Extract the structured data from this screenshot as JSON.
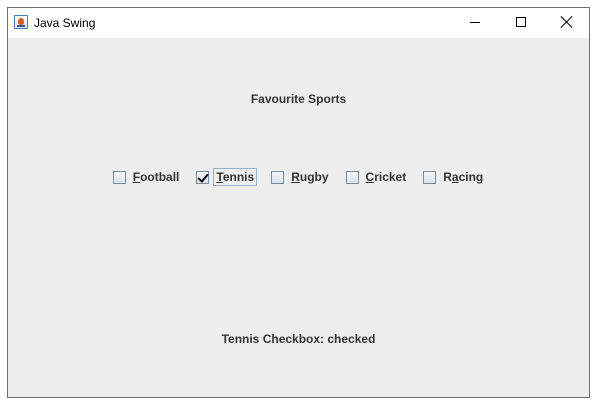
{
  "window": {
    "title": "Java Swing",
    "icon": "java-cup-icon"
  },
  "controls": {
    "minimize_icon": "minimize-icon",
    "maximize_icon": "maximize-icon",
    "close_icon": "close-icon"
  },
  "heading": "Favourite Sports",
  "checkboxes": [
    {
      "pre": "",
      "mnemonic": "F",
      "post": "ootball",
      "checked": false
    },
    {
      "pre": "",
      "mnemonic": "T",
      "post": "ennis",
      "checked": true
    },
    {
      "pre": "",
      "mnemonic": "R",
      "post": "ugby",
      "checked": false
    },
    {
      "pre": "",
      "mnemonic": "C",
      "post": "ricket",
      "checked": false
    },
    {
      "pre": "R",
      "mnemonic": "a",
      "post": "cing",
      "checked": false
    }
  ],
  "status": "Tennis Checkbox: checked",
  "colors": {
    "window_bg": "#eeeeee",
    "text": "#333333",
    "title_bar": "#ffffff"
  }
}
